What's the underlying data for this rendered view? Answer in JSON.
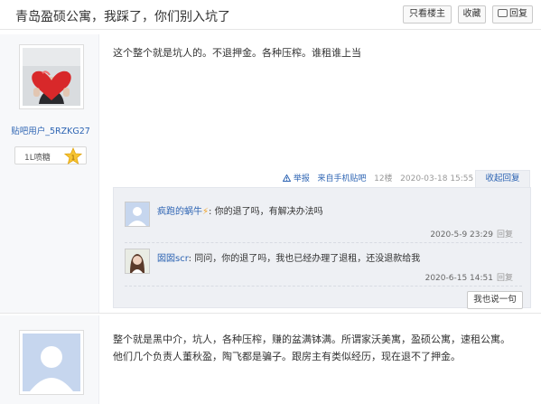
{
  "header": {
    "title": "青岛盈硕公寓，我踩了，你们别入坑了",
    "only_op_label": "只看楼主",
    "favorite_label": "收藏",
    "reply_label": "回复"
  },
  "posts": [
    {
      "username": "贴吧用户_5RZKG27",
      "level_label": "1L喷糖",
      "level_number": "1",
      "content": "这个整个就是坑人的。不退押金。各种压榨。谁租谁上当",
      "report_label": "举报",
      "source_label": "来自手机贴吧",
      "floor_label": "12楼",
      "time": "2020-03-18 15:55",
      "collapse_label": "收起回复",
      "replies": [
        {
          "name": "疯跑的蜗牛",
          "text": ": 你的退了吗，有解决办法吗",
          "time": "2020-5-9 23:29",
          "reply_label": "回复"
        },
        {
          "name": "囡囡scr",
          "text": ": 同问，你的退了吗，我也已经办理了退租，还没退款给我",
          "time": "2020-6-15 14:51",
          "reply_label": "回复"
        }
      ],
      "say_something_label": "我也说一句"
    },
    {
      "content_line1": "整个就是黑中介，坑人，各种压榨，赚的盆满钵满。所谓家沃美寓，盈硕公寓，速租公寓。",
      "content_line2": "他们几个负责人董秋盈，陶飞都是骗子。跟房主有类似经历，现在退不了押金。"
    }
  ],
  "colors": {
    "link": "#2d64b3",
    "muted": "#999999",
    "panel": "#eef0f4",
    "sidebar": "#f7f8fa"
  }
}
